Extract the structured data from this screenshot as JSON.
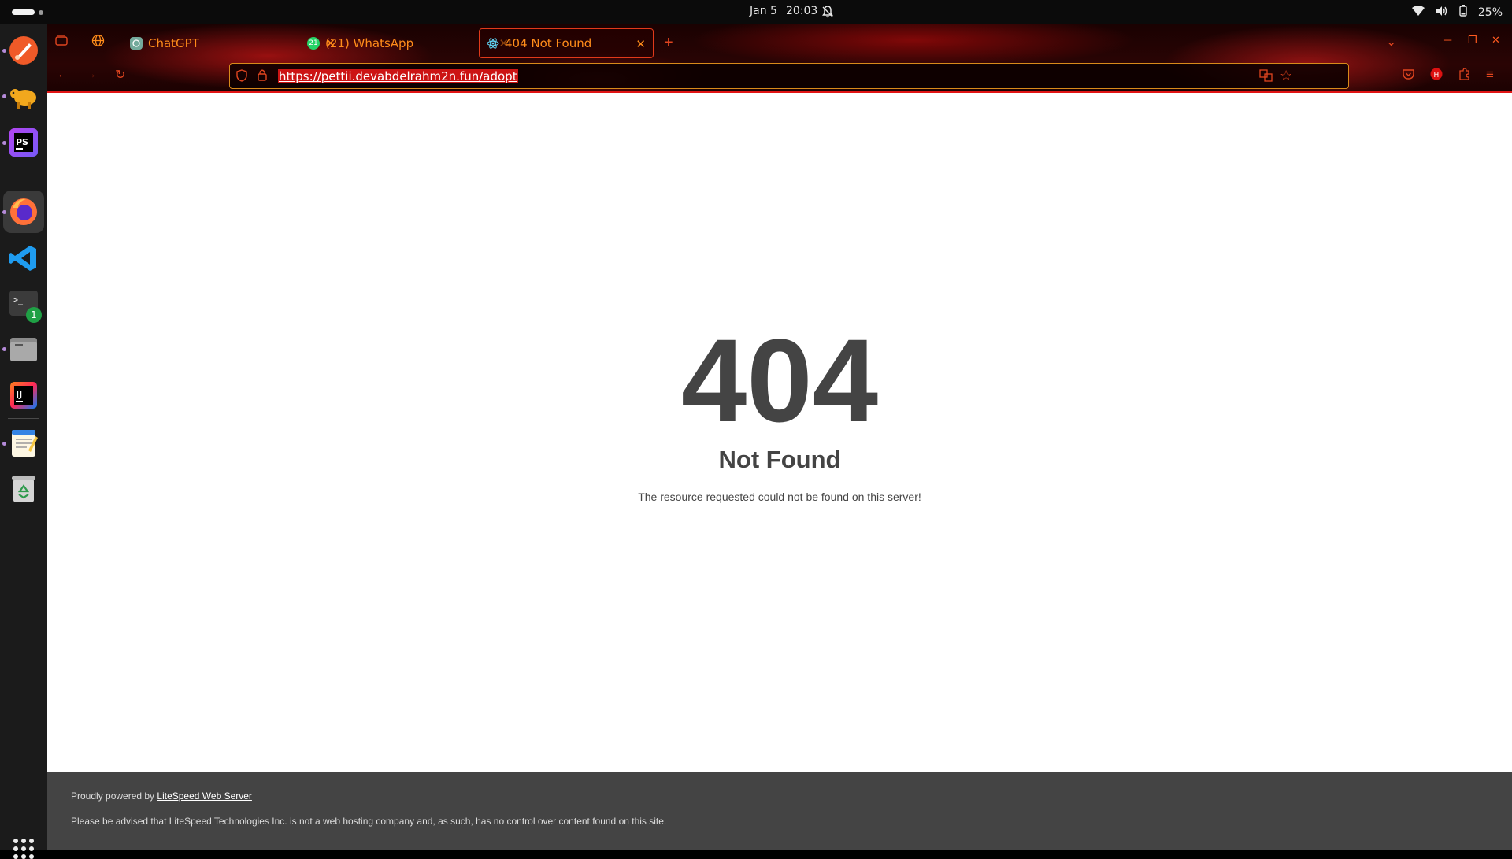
{
  "topbar": {
    "date": "Jan 5",
    "time": "20:03",
    "battery": "25%"
  },
  "dock": {
    "items": [
      "brush-app",
      "gnome-sheep-app",
      "phpstorm-app",
      "firefox-app",
      "vscode-app",
      "terminal-app",
      "files-app",
      "intellij-app",
      "text-editor-app",
      "trash-app"
    ],
    "files_badge": "1"
  },
  "browser": {
    "tabs": [
      {
        "label": "ChatGPT"
      },
      {
        "label": "(21) WhatsApp"
      },
      {
        "label": "404 Not Found"
      }
    ],
    "url": "https://pettii.devabdelrahm2n.fun/adopt"
  },
  "page": {
    "code": "404",
    "title": "Not Found",
    "message": "The resource requested could not be found on this server!",
    "footer_prefix": "Proudly powered by ",
    "footer_link": "LiteSpeed Web Server",
    "footer_notice": "Please be advised that LiteSpeed Technologies Inc. is not a web hosting company and, as such, has no control over content found on this site."
  }
}
